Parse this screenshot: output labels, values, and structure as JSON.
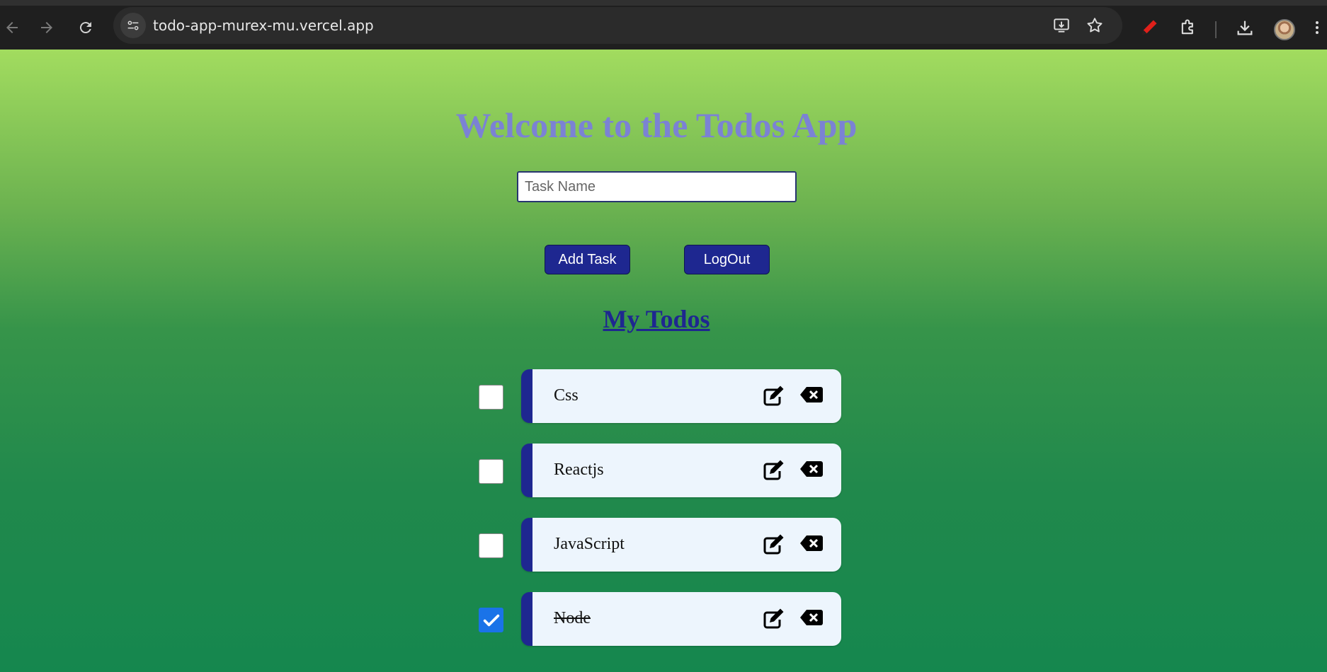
{
  "browser": {
    "url": "todo-app-murex-mu.vercel.app",
    "icons": {
      "back": "arrow-left-icon",
      "forward": "arrow-right-icon",
      "reload": "reload-icon",
      "site_info": "tune-icon",
      "install": "install-app-icon",
      "bookmark": "star-icon",
      "extension_pen": "red-pen-icon",
      "extensions": "puzzle-icon",
      "downloads": "download-icon",
      "menu": "kebab-menu-icon"
    }
  },
  "app": {
    "title": "Welcome to the Todos App",
    "task_input": {
      "placeholder": "Task Name",
      "value": ""
    },
    "add_button": "Add Task",
    "logout_button": "LogOut",
    "section_title": "My Todos",
    "todos": [
      {
        "text": "Css",
        "done": false
      },
      {
        "text": "Reactjs",
        "done": false
      },
      {
        "text": "JavaScript",
        "done": false
      },
      {
        "text": "Node",
        "done": true
      }
    ]
  },
  "colors": {
    "title": "#7b82d4",
    "accent": "#1e2790",
    "card_bg": "#edf5fd",
    "checked": "#1a73e8",
    "gradient_top": "#a2dc5f",
    "gradient_bottom": "#15874e"
  }
}
